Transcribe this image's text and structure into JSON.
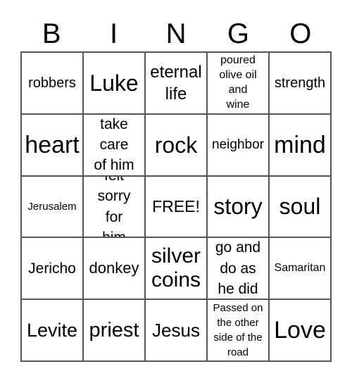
{
  "header": [
    "B",
    "I",
    "N",
    "G",
    "O"
  ],
  "cells": [
    "robbers",
    "Luke",
    "eternal life",
    "poured olive oil and wine",
    "strength",
    "heart",
    "take care of him",
    "rock",
    "neighbor",
    "mind",
    "Jerusalem",
    "felt sorry for him",
    "FREE!",
    "story",
    "soul",
    "Jericho",
    "donkey",
    "silver coins",
    "go and do as he did",
    "Samaritan",
    "Levite",
    "priest",
    "Jesus",
    "Passed on the other side of the road",
    "Love"
  ]
}
